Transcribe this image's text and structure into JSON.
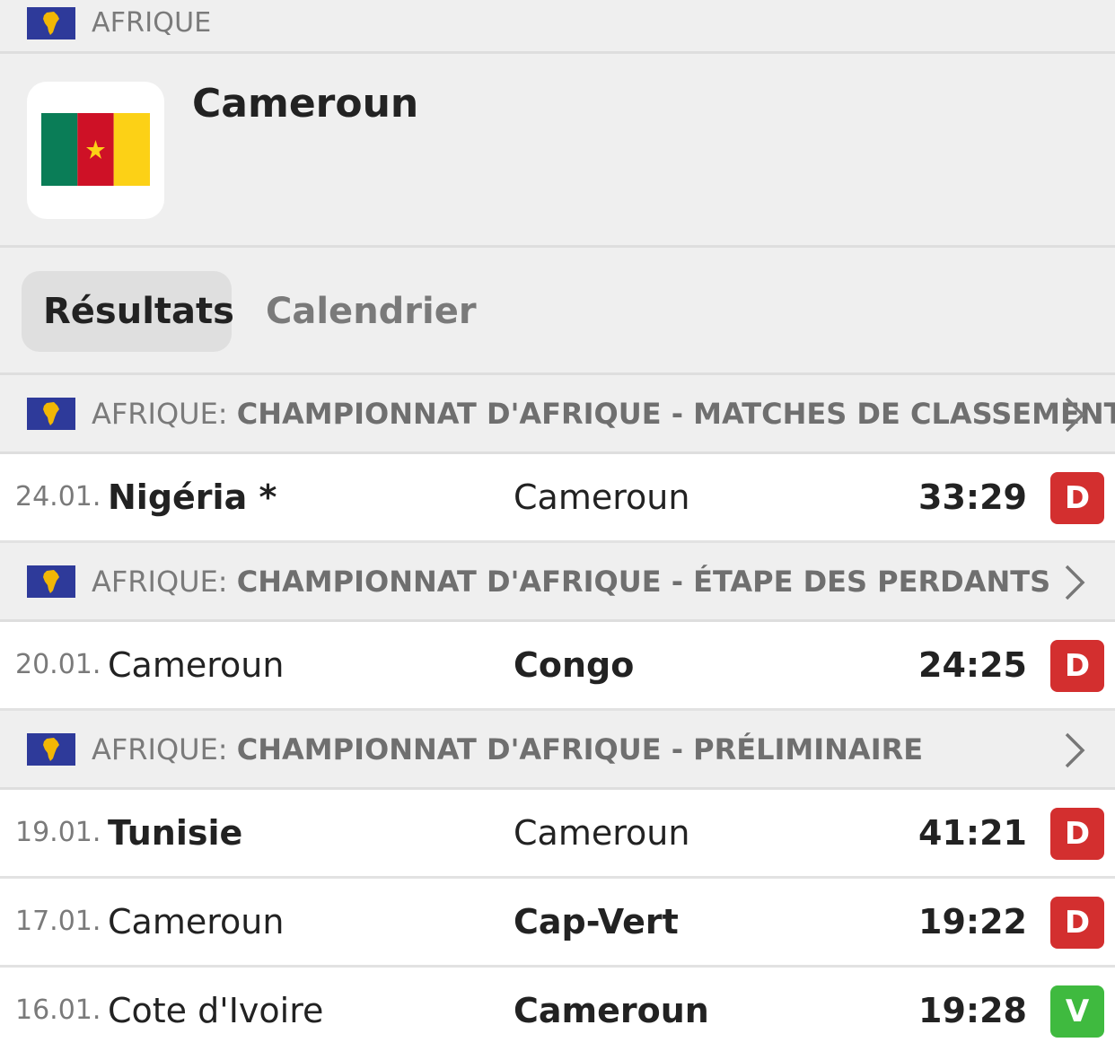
{
  "top_region": {
    "label": "AFRIQUE"
  },
  "team": {
    "name": "Cameroun"
  },
  "tabs": [
    {
      "label": "Résultats",
      "active": true
    },
    {
      "label": "Calendrier",
      "active": false
    }
  ],
  "colors": {
    "loss_badge": "#d32f2f",
    "win_badge": "#3fba3f"
  },
  "groups": [
    {
      "country": "AFRIQUE:",
      "competition": "CHAMPIONNAT D'AFRIQUE - MATCHES DE CLASSEMENT",
      "matches": [
        {
          "date": "24.01.",
          "home": "Nigéria *",
          "away": "Cameroun",
          "score": "33:29",
          "result": "D"
        }
      ]
    },
    {
      "country": "AFRIQUE:",
      "competition": "CHAMPIONNAT D'AFRIQUE - ÉTAPE DES PERDANTS",
      "matches": [
        {
          "date": "20.01.",
          "home": "Cameroun",
          "away": "Congo",
          "score": "24:25",
          "result": "D"
        }
      ]
    },
    {
      "country": "AFRIQUE:",
      "competition": "CHAMPIONNAT D'AFRIQUE - PRÉLIMINAIRE",
      "matches": [
        {
          "date": "19.01.",
          "home": "Tunisie",
          "away": "Cameroun",
          "score": "41:21",
          "result": "D"
        },
        {
          "date": "17.01.",
          "home": "Cameroun",
          "away": "Cap-Vert",
          "score": "19:22",
          "result": "D"
        },
        {
          "date": "16.01.",
          "home": "Cote d'Ivoire",
          "away": "Cameroun",
          "score": "19:28",
          "result": "V"
        }
      ]
    }
  ]
}
